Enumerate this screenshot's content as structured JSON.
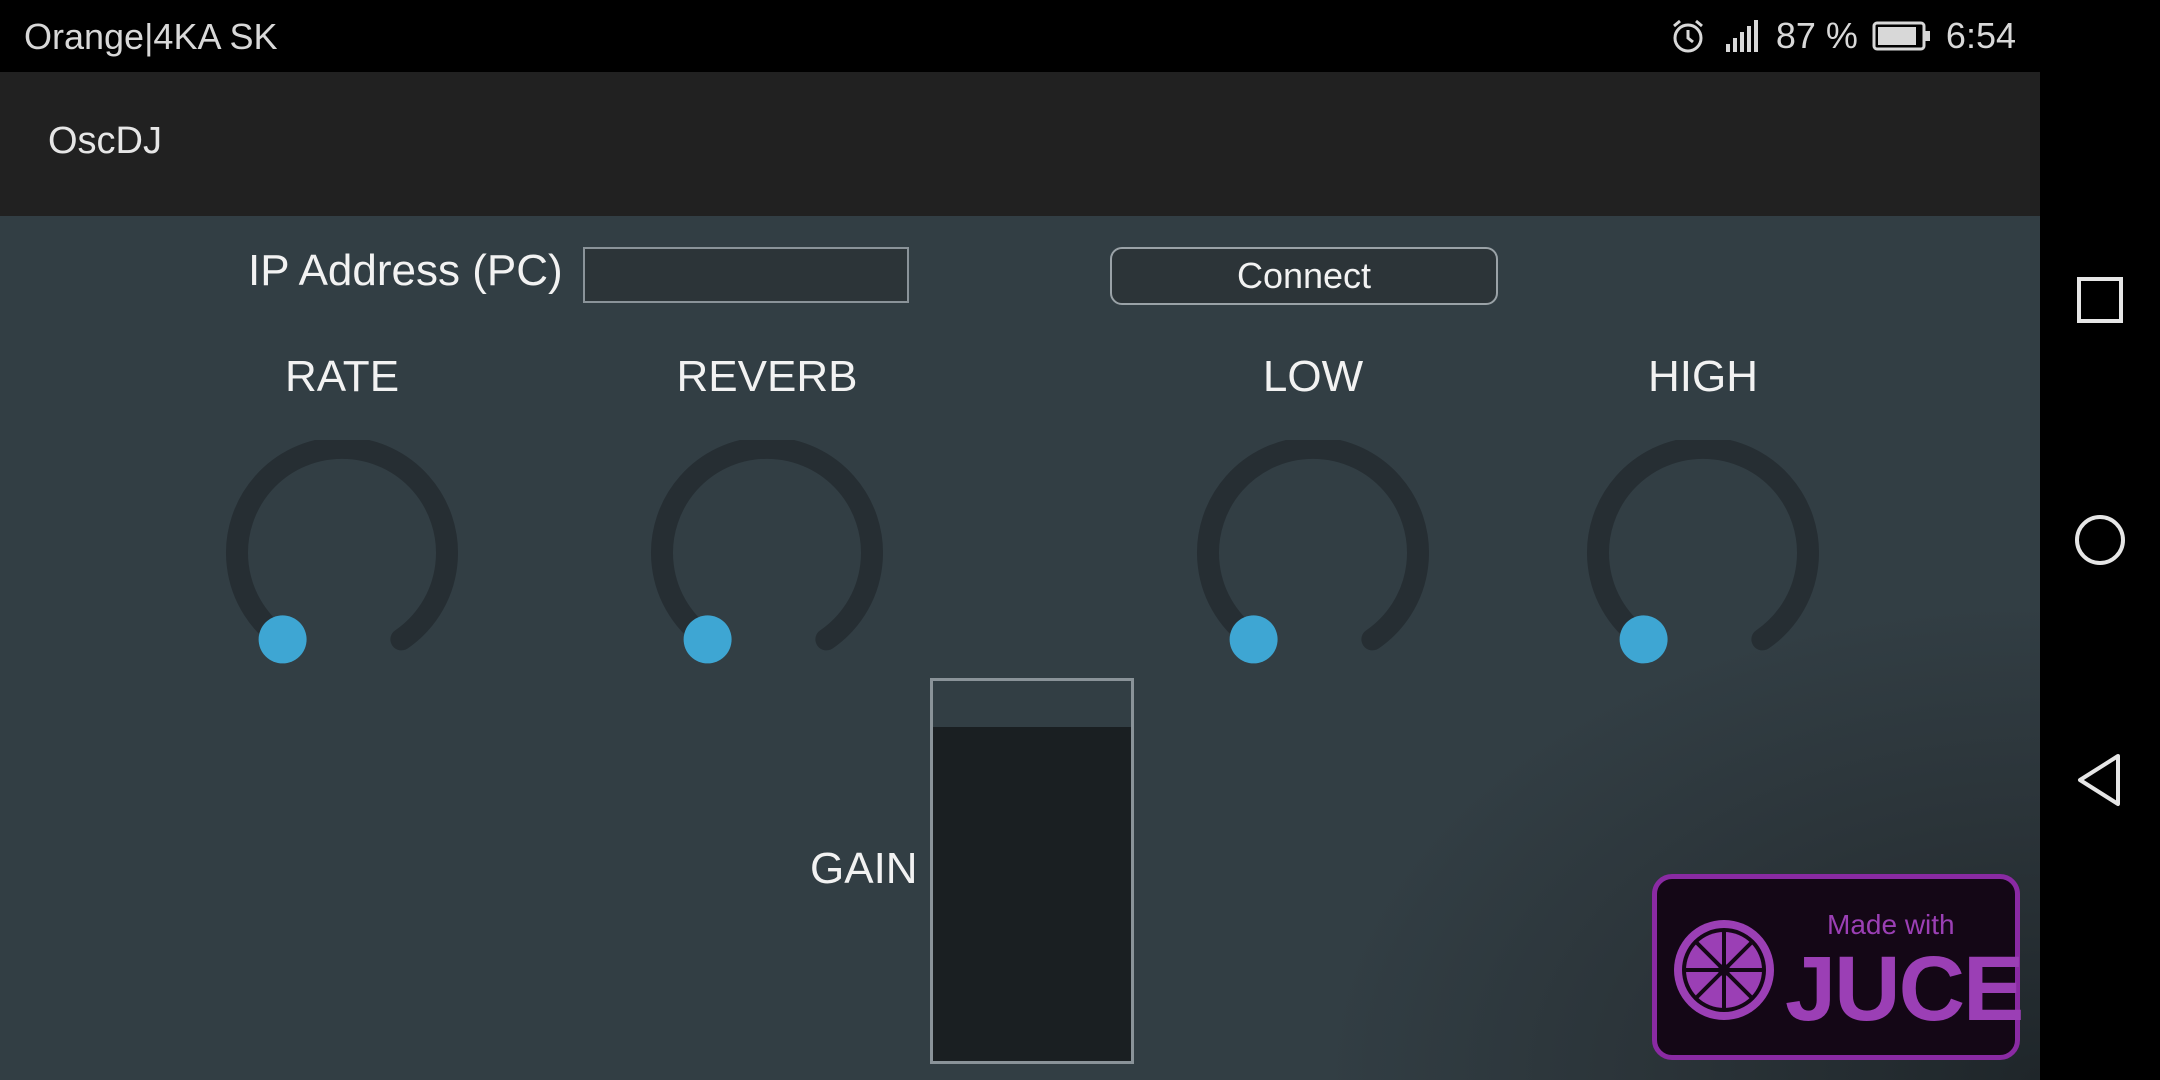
{
  "status_bar": {
    "carrier": "Orange|4KA SK",
    "battery_percent": "87 %",
    "time": "6:54",
    "icons": [
      "alarm-icon",
      "signal-icon",
      "battery-icon"
    ]
  },
  "app_bar": {
    "title": "OscDJ"
  },
  "connection": {
    "ip_label": "IP Address (PC)",
    "ip_value": "",
    "connect_label": "Connect"
  },
  "knobs": [
    {
      "label": "RATE",
      "value": 0
    },
    {
      "label": "REVERB",
      "value": 0
    },
    {
      "label": "LOW",
      "value": 0
    },
    {
      "label": "HIGH",
      "value": 0
    }
  ],
  "gain": {
    "label": "GAIN",
    "level": 0.88
  },
  "juce_logo": {
    "made_with": "Made with",
    "name": "JUCE"
  },
  "colors": {
    "accent": "#3ea6d3",
    "knob_track": "#262e33",
    "juce_purple": "#9b3fb5"
  },
  "nav_bar": {
    "icons": [
      "recents-icon",
      "home-icon",
      "back-icon"
    ]
  }
}
